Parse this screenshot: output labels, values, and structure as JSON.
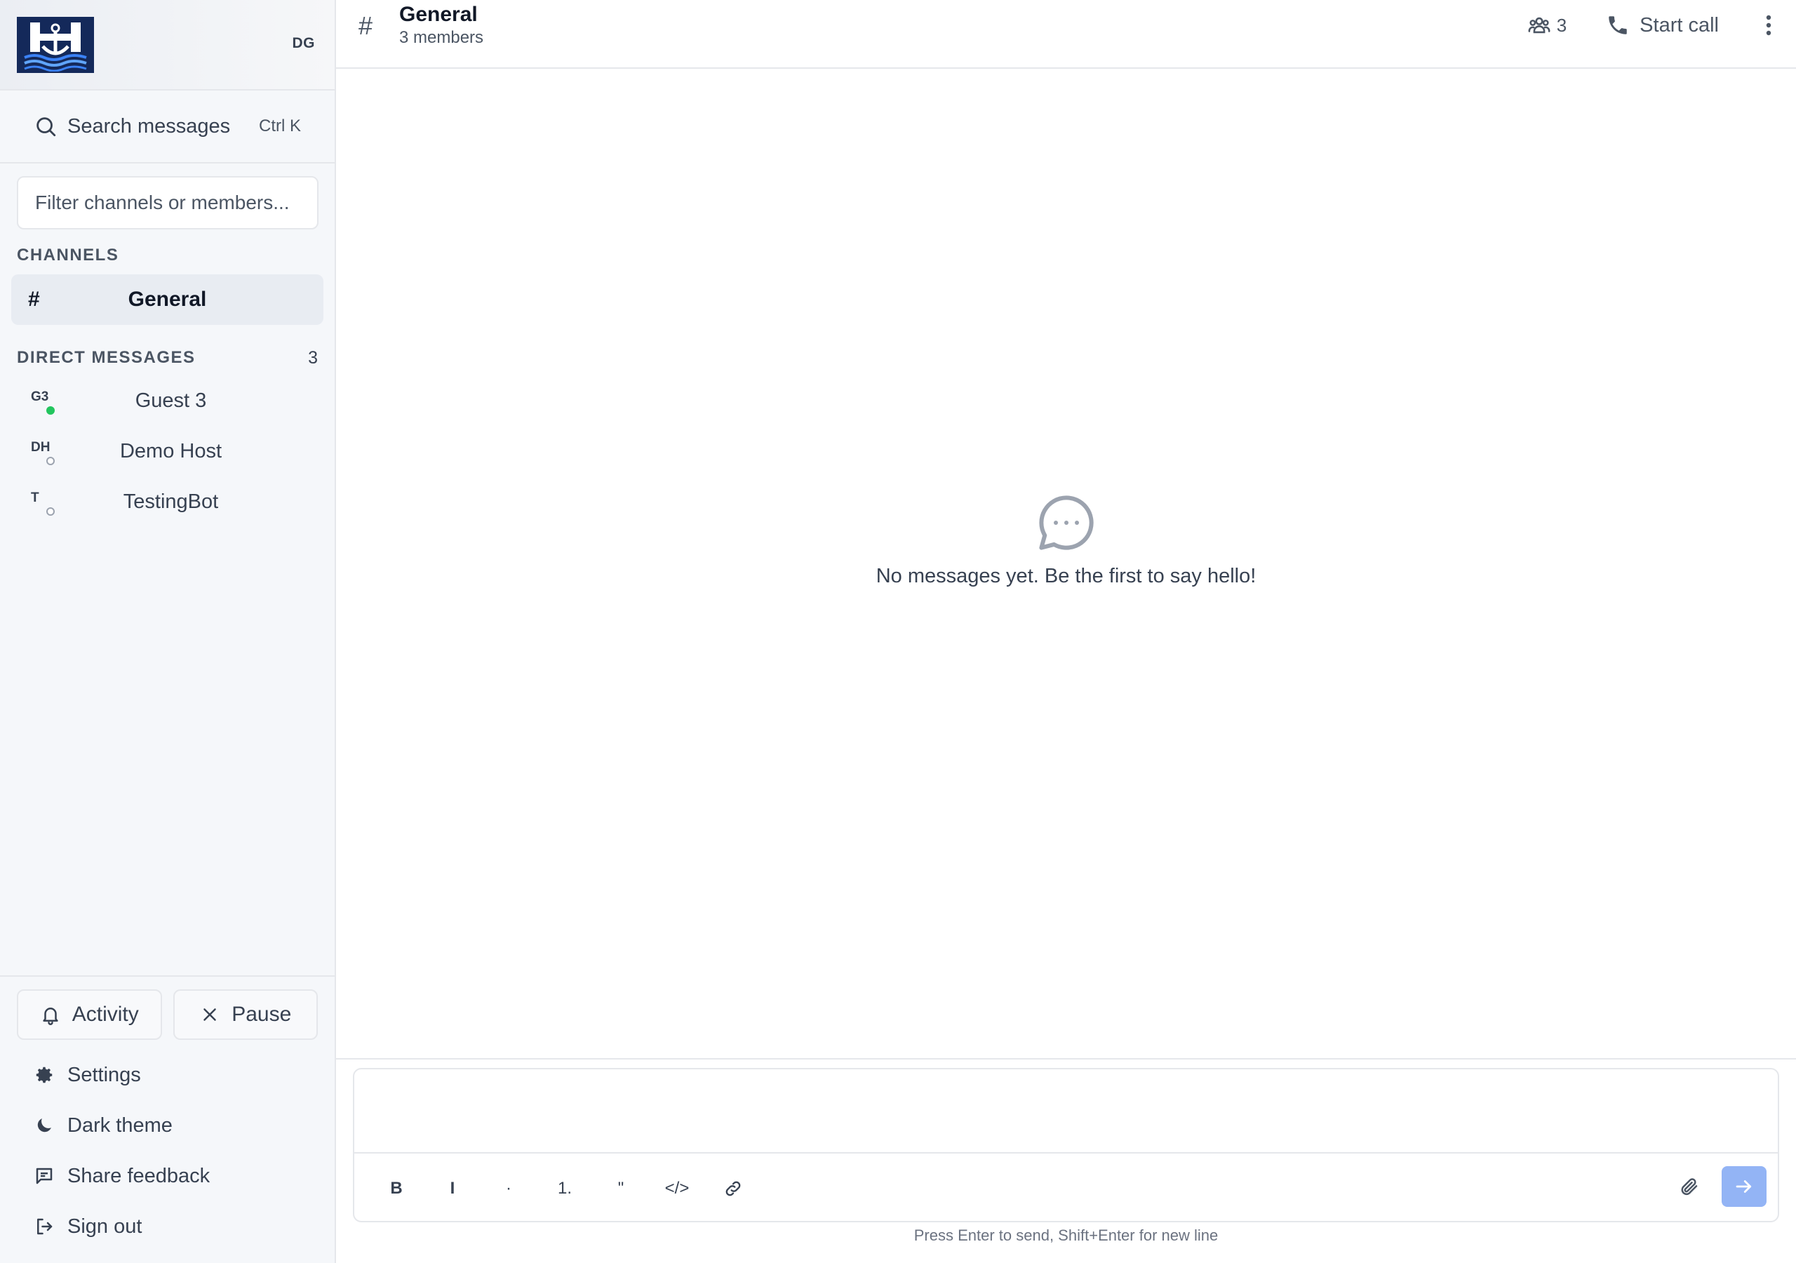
{
  "sidebar": {
    "user_initials": "DG",
    "search": {
      "label": "Search messages",
      "shortcut": "Ctrl K"
    },
    "filter": {
      "placeholder": "Filter channels or members..."
    },
    "channels_title": "CHANNELS",
    "channels": [
      {
        "label": "General",
        "active": true
      }
    ],
    "dm_title": "DIRECT MESSAGES",
    "dm_count": "3",
    "dms": [
      {
        "initials": "G3",
        "name": "Guest 3",
        "status": "online"
      },
      {
        "initials": "DH",
        "name": "Demo Host",
        "status": "offline"
      },
      {
        "initials": "T",
        "name": "TestingBot",
        "status": "offline"
      }
    ],
    "footer": {
      "activity": "Activity",
      "pause": "Pause",
      "settings": "Settings",
      "dark_theme": "Dark theme",
      "share_feedback": "Share feedback",
      "sign_out": "Sign out"
    }
  },
  "channel_header": {
    "hash": "#",
    "title": "General",
    "subtitle": "3 members",
    "member_count": "3",
    "start_call": "Start call"
  },
  "empty_state": {
    "text": "No messages yet. Be the first to say hello!"
  },
  "composer": {
    "bold": "B",
    "italic": "I",
    "bullet": "·",
    "numbered": "1.",
    "quote": "\"",
    "code": "</>",
    "hint": "Press Enter to send, Shift+Enter for new line"
  },
  "colors": {
    "accent_send": "#93b4f5",
    "logo_bg": "#14295a",
    "online": "#22c55e",
    "sidebar_bg": "#f5f7fa",
    "active_channel_bg": "#e8ecf2"
  }
}
